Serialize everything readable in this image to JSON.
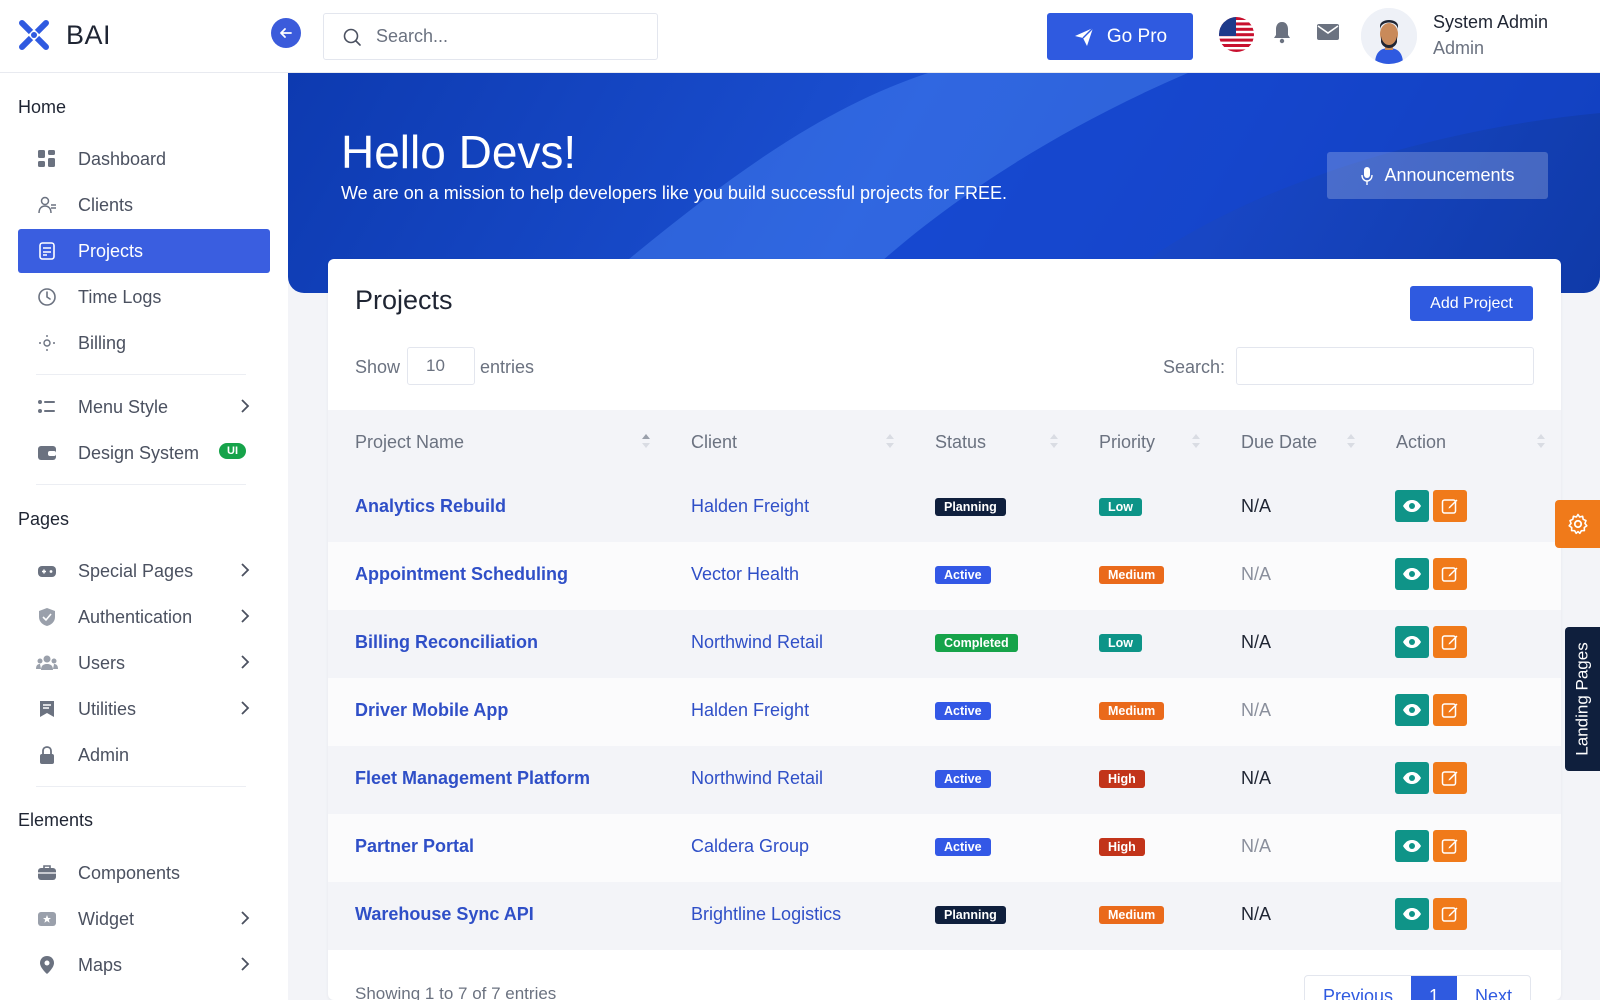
{
  "brand": {
    "name": "BAI"
  },
  "topbar": {
    "search_placeholder": "Search...",
    "go_pro_label": "Go Pro",
    "user_name": "System Admin",
    "user_role": "Admin"
  },
  "sidebar": {
    "sections": {
      "home": "Home",
      "pages": "Pages",
      "elements": "Elements"
    },
    "items": [
      {
        "label": "Dashboard",
        "icon": "grid-icon"
      },
      {
        "label": "Clients",
        "icon": "users-icon"
      },
      {
        "label": "Projects",
        "icon": "document-icon",
        "active": true
      },
      {
        "label": "Time Logs",
        "icon": "clock-icon"
      },
      {
        "label": "Billing",
        "icon": "sun-icon"
      },
      {
        "label": "Menu Style",
        "icon": "menu-style-icon"
      },
      {
        "label": "Design System",
        "icon": "wallet-icon",
        "badge": "UI"
      },
      {
        "label": "Special Pages",
        "icon": "gamepad-icon"
      },
      {
        "label": "Authentication",
        "icon": "shield-icon"
      },
      {
        "label": "Users",
        "icon": "people-icon"
      },
      {
        "label": "Utilities",
        "icon": "bookmark-icon"
      },
      {
        "label": "Admin",
        "icon": "lock-icon"
      },
      {
        "label": "Components",
        "icon": "briefcase-icon"
      },
      {
        "label": "Widget",
        "icon": "star-icon"
      },
      {
        "label": "Maps",
        "icon": "pin-icon"
      }
    ]
  },
  "banner": {
    "title": "Hello Devs!",
    "subtitle": "We are on a mission to help developers like you build successful projects for FREE.",
    "announcements_label": "Announcements"
  },
  "projects_card": {
    "title": "Projects",
    "add_button": "Add Project",
    "show_label": "Show",
    "entries_value": "10",
    "entries_label": "entries",
    "search_label": "Search:",
    "columns": [
      "Project Name",
      "Client",
      "Status",
      "Priority",
      "Due Date",
      "Action"
    ],
    "rows": [
      {
        "name": "Analytics Rebuild",
        "client": "Halden Freight",
        "status": "Planning",
        "priority": "Low",
        "due": "N/A"
      },
      {
        "name": "Appointment Scheduling",
        "client": "Vector Health",
        "status": "Active",
        "priority": "Medium",
        "due": "N/A"
      },
      {
        "name": "Billing Reconciliation",
        "client": "Northwind Retail",
        "status": "Completed",
        "priority": "Low",
        "due": "N/A"
      },
      {
        "name": "Driver Mobile App",
        "client": "Halden Freight",
        "status": "Active",
        "priority": "Medium",
        "due": "N/A"
      },
      {
        "name": "Fleet Management Platform",
        "client": "Northwind Retail",
        "status": "Active",
        "priority": "High",
        "due": "N/A"
      },
      {
        "name": "Partner Portal",
        "client": "Caldera Group",
        "status": "Active",
        "priority": "High",
        "due": "N/A"
      },
      {
        "name": "Warehouse Sync API",
        "client": "Brightline Logistics",
        "status": "Planning",
        "priority": "Medium",
        "due": "N/A"
      }
    ],
    "footer_text": "Showing 1 to 7 of 7 entries",
    "pagination": {
      "previous": "Previous",
      "current": "1",
      "next": "Next"
    }
  },
  "floating": {
    "landing_pages": "Landing Pages"
  },
  "colors": {
    "primary": "#2f5ae0",
    "sidebar_active": "#3a5ee0",
    "view_action": "#0f9488",
    "edit_action": "#f07a1a"
  }
}
